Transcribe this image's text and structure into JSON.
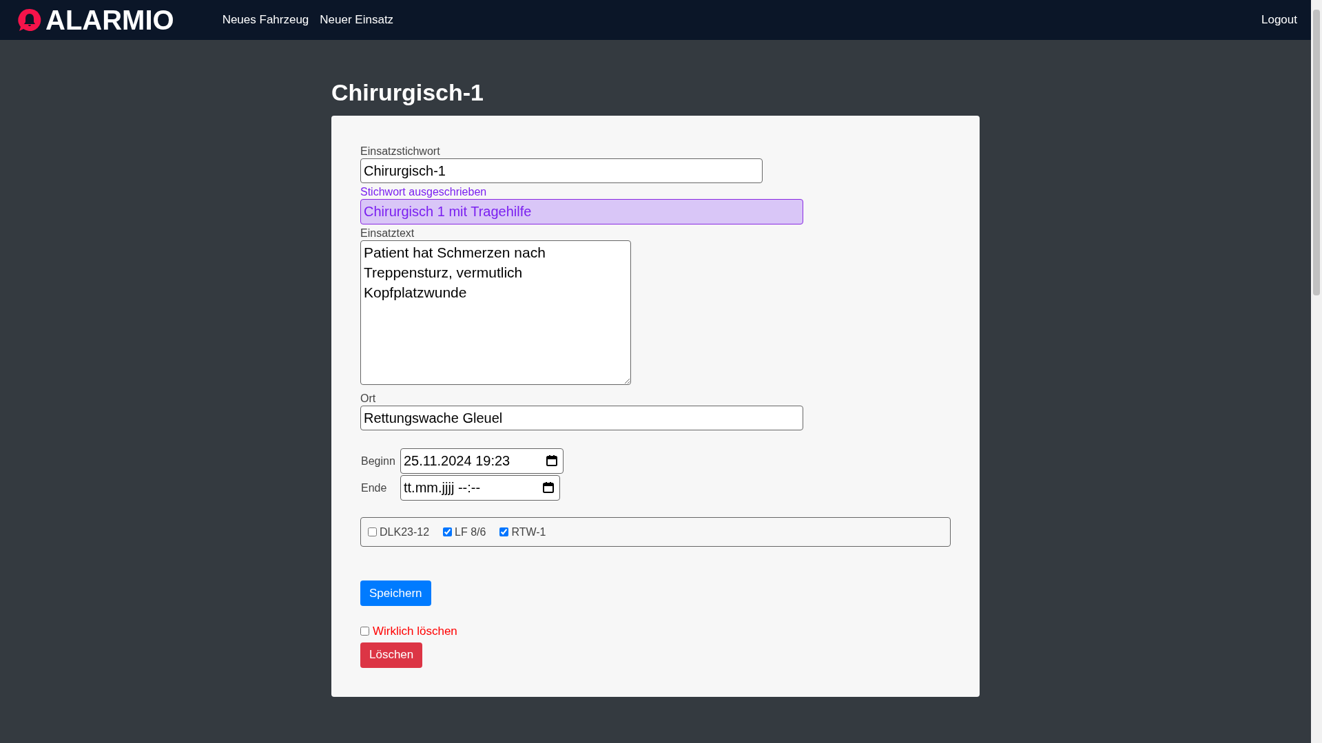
{
  "navbar": {
    "brand": "ALARMIO",
    "links": [
      "Neues Fahrzeug",
      "Neuer Einsatz"
    ],
    "logout": "Logout"
  },
  "page_title": "Chirurgisch-1",
  "form": {
    "keyword": {
      "label": "Einsatzstichwort",
      "value": "Chirurgisch-1"
    },
    "keyword_full": {
      "label": "Stichwort ausgeschrieben",
      "value": "Chirurgisch 1 mit Tragehilfe"
    },
    "text": {
      "label": "Einsatztext",
      "value": "Patient hat Schmerzen nach Treppensturz, vermutlich Kopfplatzwunde"
    },
    "location": {
      "label": "Ort",
      "value": "Rettungswache Gleuel"
    },
    "start": {
      "label": "Beginn",
      "value": "25.11.2024 19:23"
    },
    "end": {
      "label": "Ende",
      "placeholder": "tt.mm.jjjj --:--"
    },
    "vehicles": [
      {
        "label": "DLK23-12",
        "checked": false
      },
      {
        "label": "LF 8/6",
        "checked": true
      },
      {
        "label": "RTW-1",
        "checked": true
      }
    ],
    "save_button": "Speichern",
    "confirm_delete": {
      "label": "Wirklich löschen",
      "checked": false
    },
    "delete_button": "Löschen"
  }
}
